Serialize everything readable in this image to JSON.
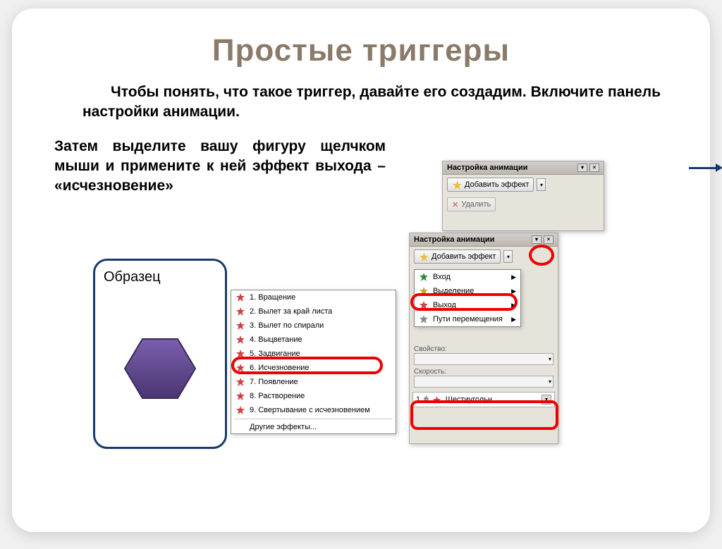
{
  "title": "Простые триггеры",
  "para1": "Чтобы понять, что такое триггер, давайте его создадим.  Включите панель настройки анимации.",
  "para2": "Затем выделите  вашу фигуру щелчком мыши и примените к ней эффект выхода – «исчезновение»",
  "sample_label": "Образец",
  "panel_title": "Настройка анимации",
  "add_effect": "Добавить эффект",
  "delete": "Удалить",
  "menu": {
    "entry": "Вход",
    "emphasis": "Выделение",
    "exit": "Выход",
    "motion": "Пути перемещения"
  },
  "effects": {
    "e1": "1. Вращение",
    "e2": "2. Вылет за край листа",
    "e3": "3. Вылет по спирали",
    "e4": "4. Выцветание",
    "e5": "5. Задвигание",
    "e6": "6. Исчезновение",
    "e7": "7. Появление",
    "e8": "8. Растворение",
    "e9": "9. Свертывание с исчезновением",
    "other": "Другие эффекты..."
  },
  "property_lbl": "Свойство:",
  "speed_lbl": "Скорость:",
  "anim_item": {
    "num": "1",
    "name": "Шестиугольн..."
  }
}
